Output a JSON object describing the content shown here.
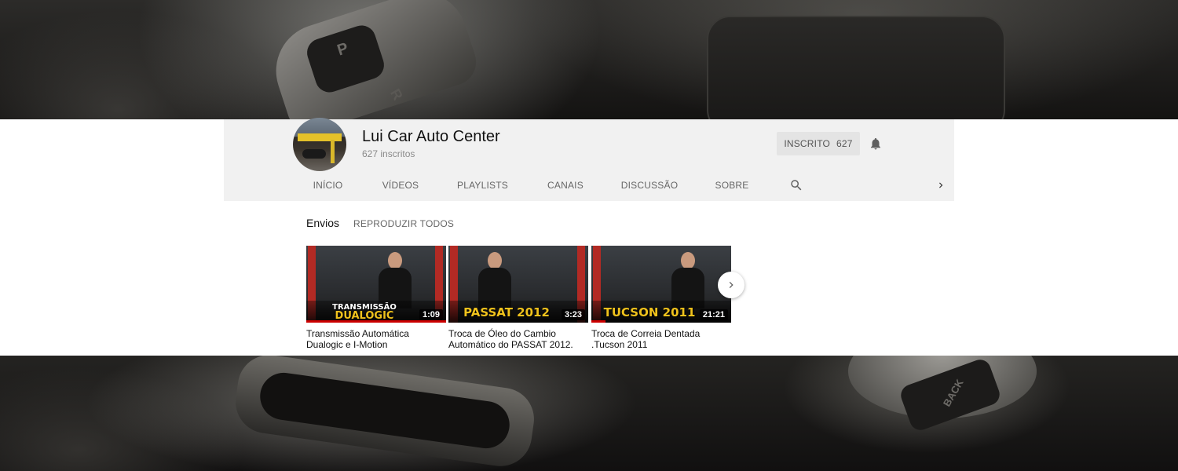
{
  "channel": {
    "name": "Lui Car Auto Center",
    "subscribers": "627 inscritos",
    "subscribe_label": "INSCRITO",
    "subscribe_count": "627"
  },
  "tabs": [
    {
      "label": "INÍCIO",
      "active": true
    },
    {
      "label": "VÍDEOS",
      "active": false
    },
    {
      "label": "PLAYLISTS",
      "active": false
    },
    {
      "label": "CANAIS",
      "active": false
    },
    {
      "label": "DISCUSSÃO",
      "active": false
    },
    {
      "label": "SOBRE",
      "active": false
    }
  ],
  "shelf": {
    "title": "Envios",
    "play_all": "REPRODUZIR TODOS"
  },
  "videos": [
    {
      "caption_top": "TRANSMISSÃO",
      "caption": "DUALOGIC",
      "duration": "1:09",
      "title": "Transmissão Automática Dualogic e I-Motion",
      "watched": 1.0
    },
    {
      "caption": "PASSAT 2012",
      "duration": "3:23",
      "title": "Troca de Óleo do Cambio Automático do PASSAT 2012.",
      "watched": 0
    },
    {
      "caption": "TUCSON 2011",
      "duration": "21:21",
      "title": "Troca de Correia Dentada .Tucson 2011",
      "watched": 0.1
    }
  ],
  "background": {
    "shifter_letters": [
      "P",
      "R"
    ],
    "button_label": "BACK"
  },
  "colors": {
    "accent_red": "#cc0000",
    "caption_yellow": "#f0c21c",
    "header_bg": "#f1f1f1"
  },
  "icons": {
    "bell": "bell-icon",
    "search": "search-icon",
    "tabs_next": "chevron-right-icon",
    "shelf_next": "chevron-right-icon"
  }
}
